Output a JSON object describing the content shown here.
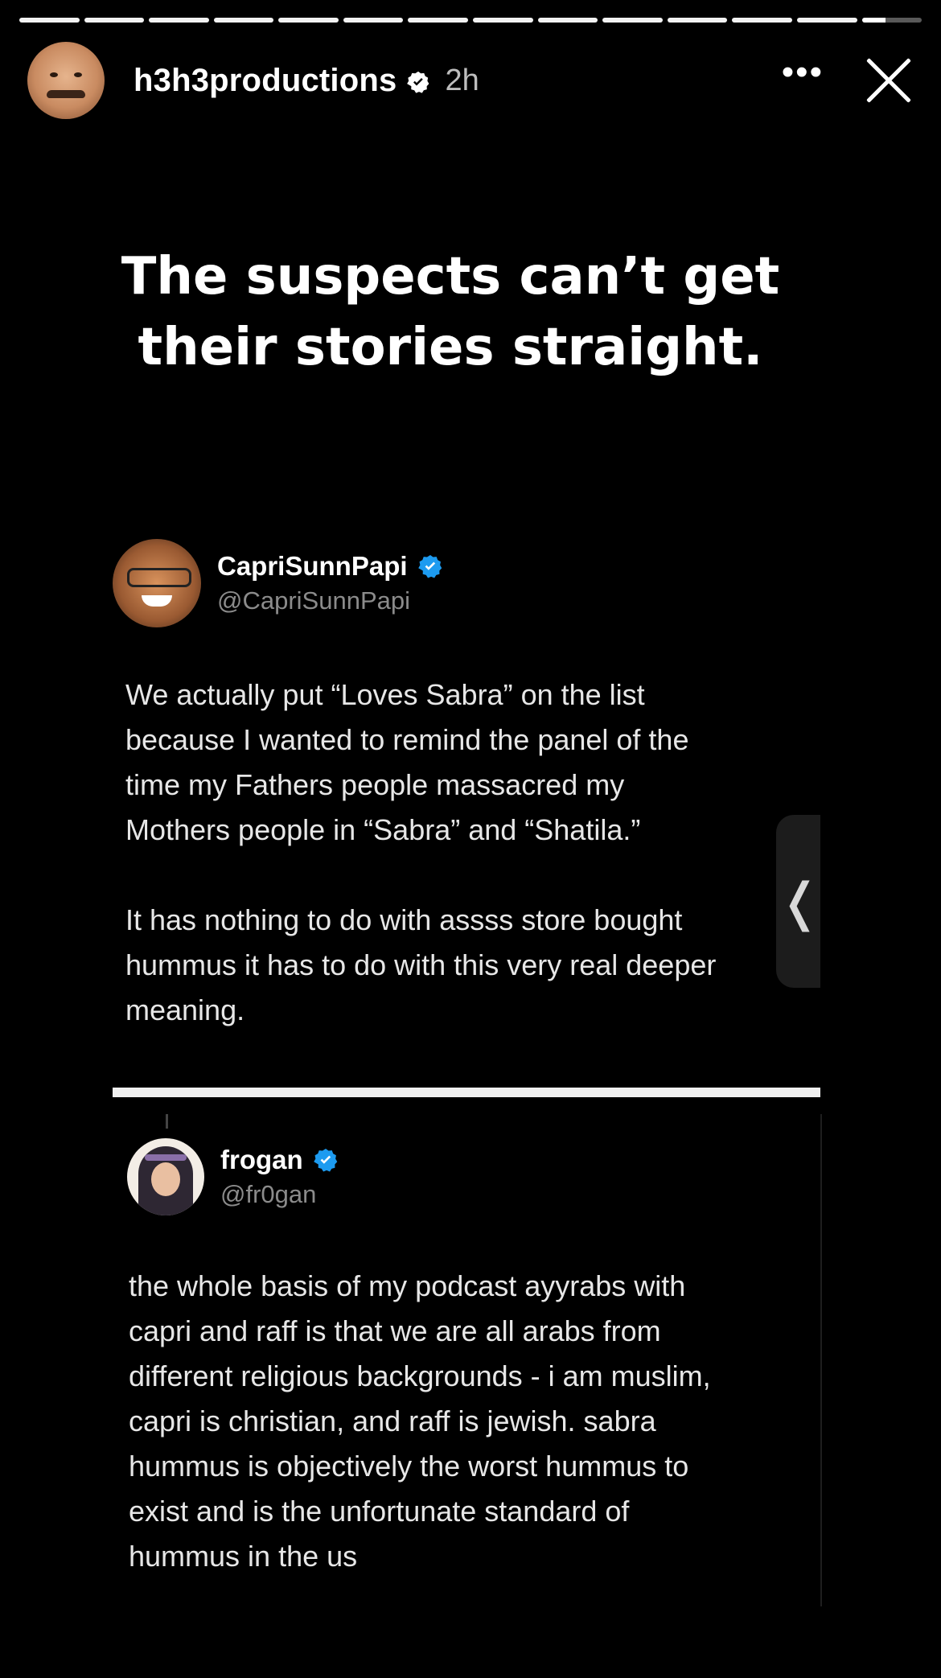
{
  "story": {
    "segments_total": 14,
    "current_segment_progress": 0.4
  },
  "header": {
    "username": "h3h3productions",
    "time_ago": "2h",
    "more_icon": "•••"
  },
  "headline": {
    "line1": "The suspects can’t get",
    "line2": "their stories straight."
  },
  "tweets": [
    {
      "display_name": "CapriSunnPapi",
      "handle": "@CapriSunnPapi",
      "body": "We actually put “Loves Sabra” on the list\nbecause I wanted to remind the panel of the\ntime my Fathers people massacred my\nMothers people in “Sabra” and “Shatila.”\n\nIt has nothing to do with assss store bought\nhummus it has to do with this very real deeper\nmeaning."
    },
    {
      "display_name": "frogan",
      "handle": "@fr0gan",
      "body": "the whole basis of my podcast ayyrabs with\ncapri and raff is that we are all arabs from\ndifferent religious backgrounds - i am muslim,\ncapri is christian, and raff is jewish. sabra\nhummus is objectively the worst hummus to\nexist and is the unfortunate standard of\nhummus in the us"
    }
  ],
  "side_handle": {
    "glyph": "❬"
  },
  "colors": {
    "background": "#000000",
    "verified_blue": "#1d9bf0",
    "text": "#ffffff"
  }
}
